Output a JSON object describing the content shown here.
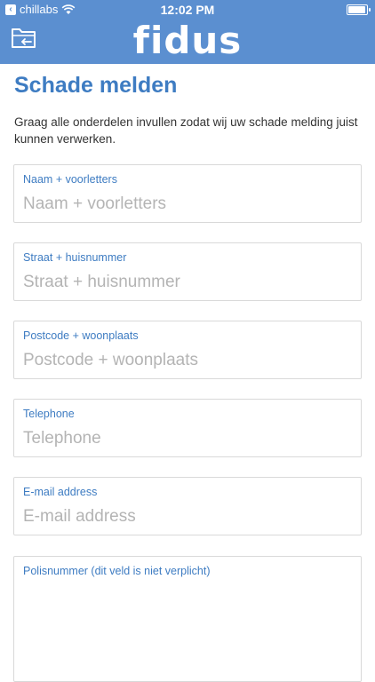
{
  "status_bar": {
    "carrier": "chillabs",
    "time": "12:02 PM",
    "battery_level": 0.95
  },
  "header": {
    "brand": "fidus",
    "back_icon": "folder-back-icon",
    "color": "#5b8fd0"
  },
  "page": {
    "title": "Schade melden",
    "intro": "Graag alle onderdelen invullen zodat wij uw schade melding juist kunnen verwerken."
  },
  "form": {
    "name": {
      "label": "Naam + voorletters",
      "placeholder": "Naam + voorletters",
      "value": ""
    },
    "street": {
      "label": "Straat + huisnummer",
      "placeholder": "Straat + huisnummer",
      "value": ""
    },
    "postcode": {
      "label": "Postcode + woonplaats",
      "placeholder": "Postcode + woonplaats",
      "value": ""
    },
    "telephone": {
      "label": "Telephone",
      "placeholder": "Telephone",
      "value": ""
    },
    "email": {
      "label": "E-mail address",
      "placeholder": "E-mail address",
      "value": ""
    },
    "policy": {
      "label": "Polisnummer (dit veld is niet verplicht)",
      "value": ""
    }
  },
  "colors": {
    "accent": "#3e7cc2",
    "border": "#d9d9d9",
    "placeholder": "#b4b4b4"
  }
}
